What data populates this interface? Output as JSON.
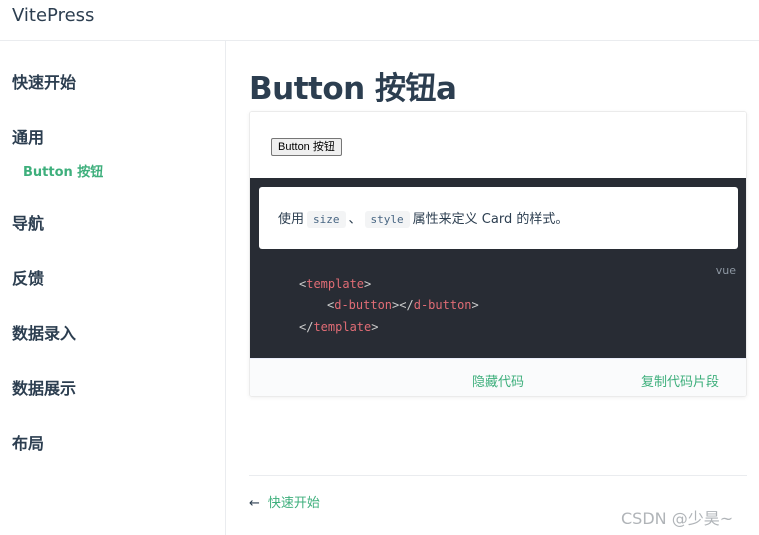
{
  "navbar": {
    "site_title": "VitePress"
  },
  "sidebar": {
    "groups": [
      {
        "label": "快速开始"
      },
      {
        "label": "通用",
        "links": [
          {
            "label": "Button 按钮"
          }
        ]
      },
      {
        "label": "导航"
      },
      {
        "label": "反馈"
      },
      {
        "label": "数据录入"
      },
      {
        "label": "数据展示"
      },
      {
        "label": "布局"
      }
    ]
  },
  "page": {
    "title": "Button 按钮a",
    "demo": {
      "button_label": "Button 按钮",
      "description": {
        "prefix": "使用",
        "code1": "size",
        "separator": "、",
        "code2": "style",
        "suffix": "属性来定义 Card 的样式。"
      },
      "code_lang": "vue",
      "code": {
        "line1_open": "<",
        "line1_tag": "template",
        "line1_close": ">",
        "line2_open": "<",
        "line2_tag": "d-button",
        "line2_mid": "></",
        "line2_tag2": "d-button",
        "line2_close": ">",
        "line3_open": "</",
        "line3_tag": "template",
        "line3_close": ">"
      },
      "hide_code_label": "隐藏代码",
      "copy_code_label": "复制代码片段"
    },
    "prev_link": {
      "arrow": "←",
      "label": "快速开始"
    }
  },
  "watermark": "CSDN @少昊~",
  "colors": {
    "accent": "#3eaf7c",
    "code_bg": "#282c34",
    "tag": "#e06c75",
    "text": "#2c3e50"
  }
}
